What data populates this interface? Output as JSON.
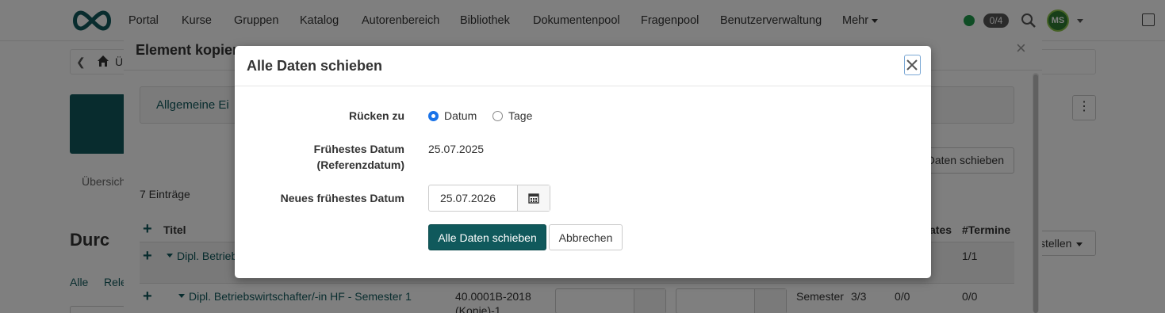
{
  "nav": {
    "items": [
      "Portal",
      "Kurse",
      "Gruppen",
      "Katalog",
      "Autorenbereich",
      "Bibliothek",
      "Dokumentenpool",
      "Fragenpool",
      "Benutzerverwaltung",
      "Mehr"
    ],
    "counter": "0/4",
    "avatar_initials": "MS"
  },
  "background": {
    "breadcrumb_text": "Ü",
    "modal_title": "Element kopiere",
    "general_panel": "Allgemeine Ei",
    "shift_button": "Daten schieben",
    "tab_overview": "Übersich",
    "entries": "7 Einträge",
    "heading": "Durc",
    "sub_tabs": [
      "Alle",
      "Rele"
    ],
    "table": {
      "col_title": "Titel",
      "col_dates": "ates",
      "col_termine": "#Termine",
      "rows": [
        {
          "title": "Dipl. Betrieb",
          "termine": "1/1"
        },
        {
          "title": "Dipl. Betriebswirtschafter/-in HF - Semester 1",
          "code": "40.0001B-2018",
          "code2": "(Kopie)-1",
          "type": "Semester",
          "count": "3/3",
          "dates": "0/0",
          "termine": "0/0"
        }
      ]
    },
    "right_button": "stellen"
  },
  "dialog": {
    "title": "Alle Daten schieben",
    "shift_to_label": "Rücken zu",
    "radio_options": [
      {
        "label": "Datum",
        "selected": true
      },
      {
        "label": "Tage",
        "selected": false
      }
    ],
    "earliest_label_line1": "Frühestes Datum",
    "earliest_label_line2": "(Referenzdatum)",
    "earliest_value": "25.07.2025",
    "new_earliest_label": "Neues frühestes Datum",
    "new_earliest_value": "25.07.2026",
    "submit_label": "Alle Daten schieben",
    "cancel_label": "Abbrechen"
  },
  "colors": {
    "brand_teal": "#10595c",
    "radio_blue": "#1a73e8",
    "status_green": "#1f9a4a"
  }
}
